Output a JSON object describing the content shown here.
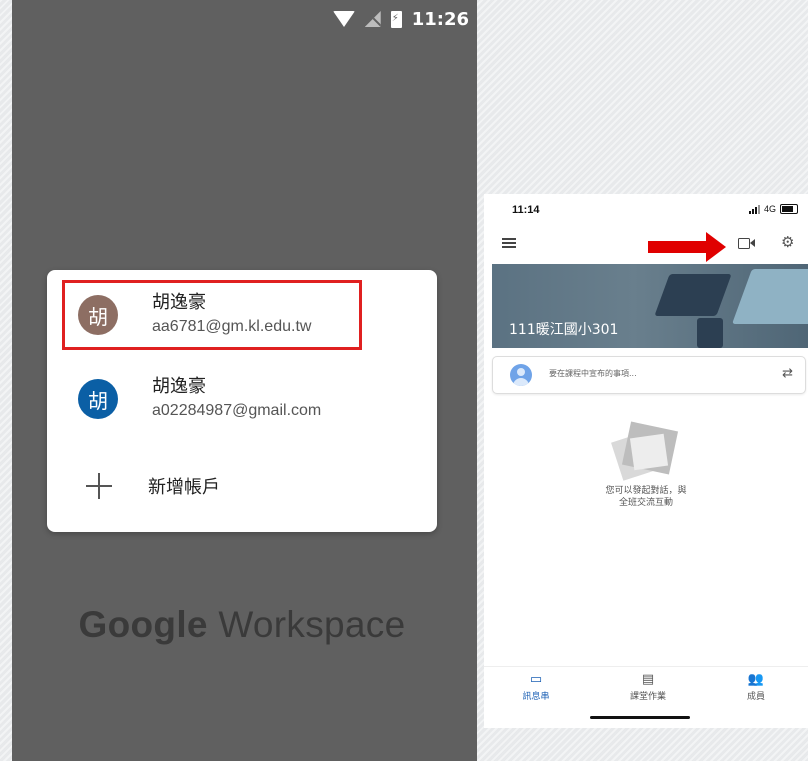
{
  "left_phone": {
    "status_time": "11:26",
    "accounts": [
      {
        "avatar_char": "胡",
        "name": "胡逸豪",
        "email": "aa6781@gm.kl.edu.tw",
        "avatar_color": "#8d6e63"
      },
      {
        "avatar_char": "胡",
        "name": "胡逸豪",
        "email": "a02284987@gmail.com",
        "avatar_color": "#0b5fa5"
      }
    ],
    "add_account_label": "新增帳戶",
    "brand_logo_google": "Google",
    "brand_logo_workspace": " Workspace"
  },
  "right_phone": {
    "status_time": "11:14",
    "network": "4G",
    "class_title": "111暖江國小301",
    "post_placeholder": "要在課程中宣布的事項...",
    "empty_line1": "您可以發起對話，與",
    "empty_line2": "全班交流互動",
    "nav": [
      {
        "label": "訊息串",
        "icon": "stream-icon"
      },
      {
        "label": "課堂作業",
        "icon": "classwork-icon"
      },
      {
        "label": "成員",
        "icon": "people-icon"
      }
    ]
  },
  "colors": {
    "highlight": "#e02020",
    "arrow": "#e00000",
    "active_nav": "#1a5fb4"
  }
}
